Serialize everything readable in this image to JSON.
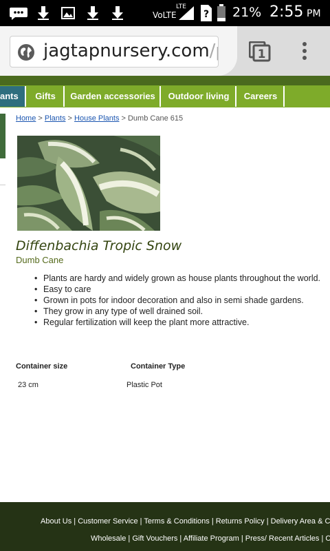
{
  "status_bar": {
    "network": "VoLTE",
    "lte": "LTE",
    "battery": "21%",
    "time": "2:55",
    "ampm": "PM"
  },
  "browser": {
    "url_main": "jagtapnursery.com",
    "url_rest": "/pla",
    "tab_count": "1"
  },
  "nav": {
    "items": [
      {
        "label": "ants",
        "active": true
      },
      {
        "label": "Gifts",
        "active": false
      },
      {
        "label": "Garden accessories",
        "active": false
      },
      {
        "label": "Outdoor living",
        "active": false
      },
      {
        "label": "Careers",
        "active": false
      }
    ]
  },
  "breadcrumb": {
    "home": "Home",
    "sep1": " > ",
    "plants": "Plants",
    "sep2": " > ",
    "house_plants": "House Plants",
    "current": " > Dumb Cane 615"
  },
  "product": {
    "image_icon": "plant-photo",
    "name": "Diffenbachia Tropic Snow",
    "common_name": "Dumb Cane",
    "features": [
      "Plants are hardy and widely grown as house plants throughout the world.",
      "Easy to care",
      "Grown in pots for indoor decoration and also in semi shade gardens.",
      "They grow in any type of well drained soil.",
      "Regular fertilization will keep the plant more attractive."
    ]
  },
  "specs": {
    "container_size_label": "Container size",
    "container_type_label": "Container Type",
    "container_size_value": "23 cm",
    "container_type_value": "Plastic Pot"
  },
  "footer": {
    "row1": "About Us | Customer Service | Terms & Conditions | Returns Policy | Delivery Area & Co",
    "row2": "Wholesale | Gift Vouchers | Affiliate Program | Press/ Recent Articles | C"
  },
  "colors": {
    "nav_green": "#7eab2a",
    "nav_active": "#2e6e7e",
    "footer_bg": "#253315",
    "title_color": "#33440f"
  }
}
